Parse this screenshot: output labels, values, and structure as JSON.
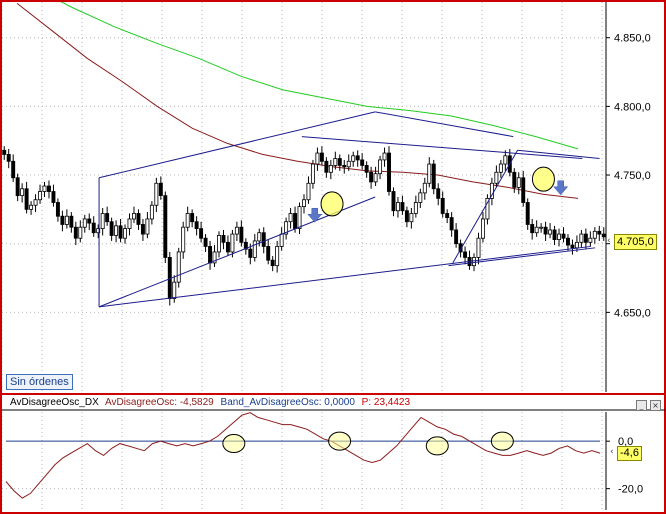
{
  "chart_data": [
    {
      "type": "candlestick",
      "y_ticks": [
        "4.850,0",
        "4.800,0",
        "4.750,0",
        "4.700,0",
        "4.650,0"
      ],
      "y_tick_values": [
        4850,
        4800,
        4750,
        4700,
        4650
      ],
      "ylim": [
        4592,
        4876
      ],
      "grid": true,
      "last_price_label": "4.705,0",
      "close_series": [
        4765,
        4760,
        4748,
        4735,
        4740,
        4725,
        4728,
        4732,
        4738,
        4742,
        4738,
        4730,
        4720,
        4714,
        4720,
        4712,
        4704,
        4712,
        4718,
        4715,
        4708,
        4711,
        4722,
        4716,
        4706,
        4713,
        4704,
        4711,
        4718,
        4722,
        4714,
        4707,
        4718,
        4728,
        4744,
        4735,
        4690,
        4660,
        4672,
        4694,
        4712,
        4722,
        4716,
        4711,
        4704,
        4698,
        4686,
        4694,
        4706,
        4701,
        4694,
        4707,
        4712,
        4701,
        4696,
        4690,
        4702,
        4708,
        4698,
        4688,
        4684,
        4698,
        4707,
        4716,
        4722,
        4711,
        4727,
        4732,
        4744,
        4758,
        4766,
        4760,
        4752,
        4757,
        4762,
        4757,
        4756,
        4760,
        4764,
        4761,
        4757,
        4752,
        4745,
        4751,
        4761,
        4766,
        4738,
        4724,
        4730,
        4724,
        4716,
        4722,
        4730,
        4737,
        4744,
        4758,
        4740,
        4733,
        4722,
        4719,
        4710,
        4700,
        4694,
        4690,
        4684,
        4690,
        4704,
        4718,
        4733,
        4744,
        4752,
        4758,
        4764,
        4752,
        4741,
        4748,
        4730,
        4714,
        4708,
        4712,
        4712,
        4707,
        4710,
        4703,
        4707,
        4704,
        4699,
        4697,
        4701,
        4707,
        4701,
        4704,
        4709,
        4707,
        4705
      ],
      "series": [
        {
          "name": "",
          "color": "#22cc22",
          "values": [
            4888,
            4872,
            4858,
            4846,
            4835,
            4822,
            4812,
            4806,
            4800,
            4797,
            4793,
            4786,
            4778,
            4769
          ]
        },
        {
          "name": "",
          "color": "#8b1c1c",
          "values": [
            4875,
            4855,
            4835,
            4818,
            4800,
            4784,
            4773,
            4765,
            4760,
            4756,
            4753,
            4752,
            4750,
            4745,
            4741,
            4736,
            4733
          ]
        }
      ],
      "trend_lines": [
        {
          "color": "#1c1c8c",
          "from": [
            22,
            4748
          ],
          "to": [
            86,
            4796
          ]
        },
        {
          "color": "#1c1c8c",
          "from": [
            22,
            4748
          ],
          "to": [
            22,
            4654
          ]
        },
        {
          "color": "#1c1c8c",
          "from": [
            22,
            4654
          ],
          "to": [
            136,
            4698
          ]
        },
        {
          "color": "#1c1c8c",
          "from": [
            22,
            4654
          ],
          "to": [
            86,
            4734
          ]
        },
        {
          "color": "#1c1c8c",
          "from": [
            69,
            4778
          ],
          "to": [
            134,
            4762
          ]
        },
        {
          "color": "#1c1c8c",
          "from": [
            104,
            4686
          ],
          "to": [
            119,
            4768
          ]
        }
      ],
      "arrows": [
        {
          "x": 72,
          "y": 4720
        },
        {
          "x": 129,
          "y": 4740
        }
      ],
      "highlights": [
        {
          "x": 76,
          "y": 4729
        },
        {
          "x": 125,
          "y": 4747
        }
      ]
    },
    {
      "type": "line",
      "indicator": "AvDisagreeOsc_DX",
      "legend": [
        {
          "text": "AvDisagreeOsc_DX",
          "color": "#000000"
        },
        {
          "text": "AvDisagreeOsc: -4,5829",
          "color": "#8b1c1c"
        },
        {
          "text": "Band_AvDisagreeOsc: 0,0000",
          "color": "#1a3f8f"
        },
        {
          "text": "P: 23,4423",
          "color": "#cc0000"
        }
      ],
      "y_ticks": [
        "0,0",
        "-20,0"
      ],
      "y_tick_values": [
        0,
        -20
      ],
      "ylim": [
        -29,
        12.3
      ],
      "last_value_label": "-4,6",
      "band_value": 0,
      "series": [
        {
          "name": "AvDisagreeOsc",
          "color": "#8b1c1c",
          "values": [
            -17,
            -21,
            -24,
            -22,
            -18,
            -14,
            -10,
            -7,
            -5,
            -3,
            -1,
            -4,
            -6,
            -3,
            -1,
            -2,
            -3,
            -4,
            -1,
            0,
            -1,
            -2,
            -1,
            -2,
            -1,
            0,
            2,
            5,
            8,
            11,
            12,
            10,
            9,
            8,
            7,
            7,
            6,
            5,
            3,
            1,
            0,
            -2,
            -4,
            -6,
            -8,
            -9,
            -8,
            -5,
            -2,
            2,
            6,
            10,
            8,
            6,
            5,
            3,
            2,
            0,
            -2,
            -4,
            -5,
            -6,
            -6,
            -5,
            -4,
            -5,
            -6,
            -5,
            -3,
            -2,
            -4,
            -5,
            -4,
            -5
          ]
        }
      ],
      "highlights": [
        {
          "x": 28,
          "y": -1
        },
        {
          "x": 41,
          "y": 0
        },
        {
          "x": 53,
          "y": -2
        },
        {
          "x": 61,
          "y": 0
        }
      ]
    }
  ],
  "ui": {
    "orders_label": "Sin órdenes",
    "minimize_label": "_",
    "close_label": "×"
  }
}
